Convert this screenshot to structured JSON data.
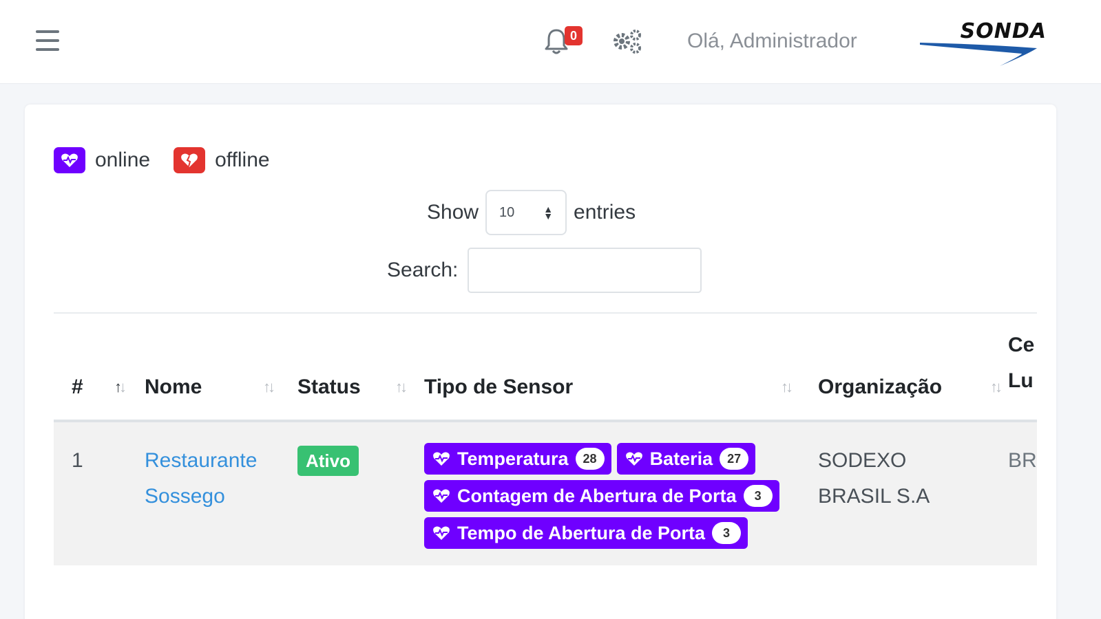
{
  "header": {
    "notifications_count": "0",
    "greeting": "Olá, Administrador",
    "logo_text": "SONDA",
    "icons": [
      "menu-icon",
      "bell-icon",
      "gears-icon"
    ]
  },
  "legend": {
    "online_label": "online",
    "offline_label": "offline",
    "online_color": "#6f00ff",
    "offline_color": "#e3342f"
  },
  "length_control": {
    "show_label": "Show",
    "value": "10",
    "entries_label": "entries"
  },
  "search": {
    "label": "Search:",
    "value": ""
  },
  "table": {
    "columns": {
      "index": "#",
      "name": "Nome",
      "status": "Status",
      "sensor_type": "Tipo de Sensor",
      "organization": "Organização",
      "extra_line1": "Ce",
      "extra_line2": "Lu"
    },
    "rows": [
      {
        "index": "1",
        "name_line1": "Restaurante",
        "name_line2": "Sossego",
        "status": "Ativo",
        "sensors": [
          {
            "label": "Temperatura",
            "count": "28"
          },
          {
            "label": "Bateria",
            "count": "27"
          },
          {
            "label": "Contagem de Abertura de Porta",
            "count": "3"
          },
          {
            "label": "Tempo de Abertura de Porta",
            "count": "3"
          }
        ],
        "organization_line1": "SODEXO",
        "organization_line2": "BRASIL S.A",
        "extra": "BR"
      }
    ]
  },
  "colors": {
    "status_active": "#38c172",
    "sensor_badge": "#6f00ff",
    "link": "#3490dc",
    "notification_badge": "#e3342f"
  }
}
